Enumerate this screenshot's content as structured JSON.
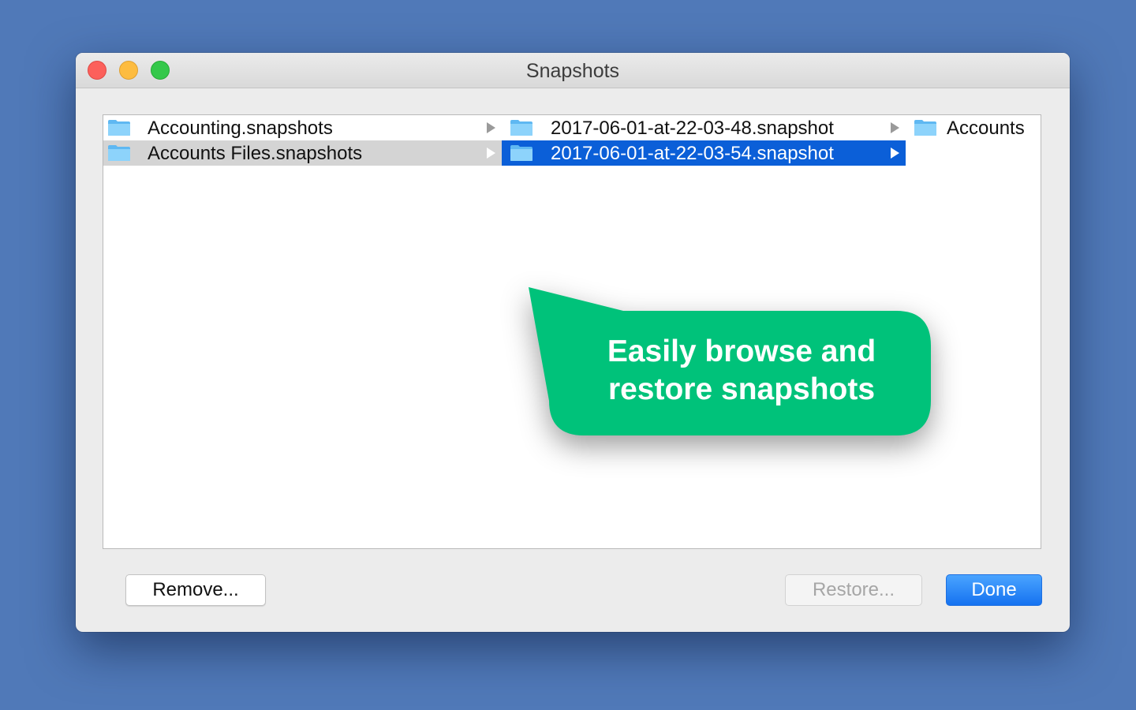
{
  "window": {
    "title": "Snapshots"
  },
  "browser": {
    "columns": [
      {
        "items": [
          {
            "label": "Accounting.snapshots",
            "icon": "folder-icon",
            "has_children": true,
            "state": "normal"
          },
          {
            "label": "Accounts Files.snapshots",
            "icon": "folder-icon",
            "has_children": true,
            "state": "selected-inactive"
          }
        ]
      },
      {
        "items": [
          {
            "label": "2017-06-01-at-22-03-48.snapshot",
            "icon": "folder-icon",
            "has_children": true,
            "state": "normal"
          },
          {
            "label": "2017-06-01-at-22-03-54.snapshot",
            "icon": "folder-icon",
            "has_children": true,
            "state": "selected-active"
          }
        ]
      },
      {
        "items": [
          {
            "label": "Accounts",
            "icon": "folder-icon",
            "has_children": false,
            "state": "normal"
          }
        ]
      }
    ]
  },
  "buttons": {
    "remove_label": "Remove...",
    "restore_label": "Restore...",
    "done_label": "Done"
  },
  "callout": {
    "line1": "Easily browse and",
    "line2": "restore snapshots"
  },
  "colors": {
    "desktop": "#5079b8",
    "selection_active": "#0b5fd8",
    "selection_inactive": "#d4d4d4",
    "callout": "#00c27a",
    "primary_button": "#1a7cf5",
    "folder": "#6cc3f7"
  }
}
